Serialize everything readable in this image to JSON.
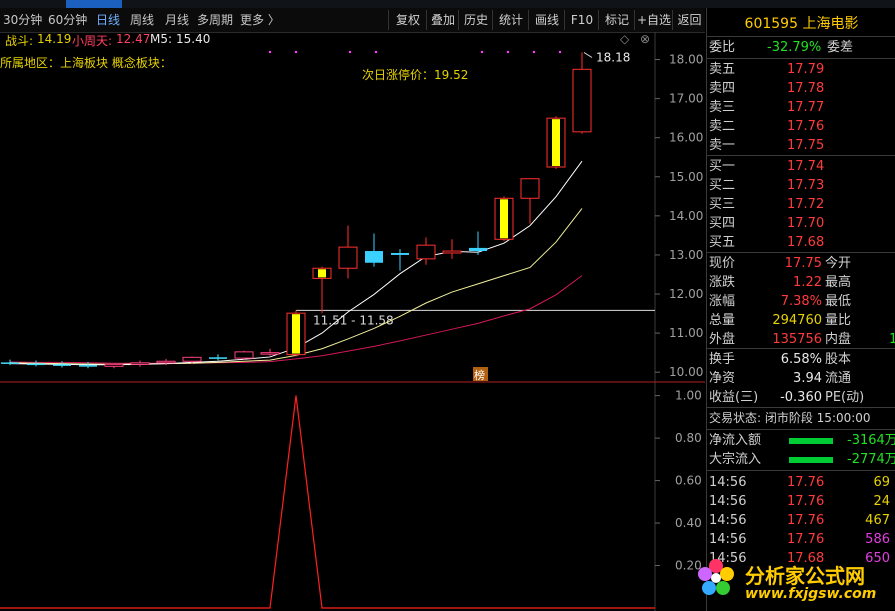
{
  "toolbar": {
    "periods": [
      "30分钟",
      "60分钟",
      "日线",
      "周线",
      "月线",
      "多周期",
      "更多 〉"
    ],
    "active_period": "日线",
    "right_buttons": [
      "复权",
      "叠加",
      "历史",
      "统计",
      "画线",
      "F10",
      "标记",
      "+自选",
      "返回"
    ]
  },
  "indicators": {
    "zhandou_label": "战斗:",
    "zhandou_value": "14.19",
    "xiaozhoutian_label": "小周天:",
    "xiaozhoutian_value": "12.47",
    "m5_label": "M5:",
    "m5_value": "15.40",
    "sector_line": "所属地区：上海板块   概念板块："
  },
  "annotations": {
    "limit_up_next_day": "次日涨停价：19.52",
    "high_price": "18.18",
    "range_label": "11.51 - 11.58",
    "bang_marker": "榜"
  },
  "chart_data": {
    "type": "candlestick",
    "price_axis": {
      "ticks": [
        "18.00",
        "17.00",
        "16.00",
        "15.00",
        "14.00",
        "13.00",
        "12.00",
        "11.00",
        "10.00"
      ],
      "ylim": [
        9.8,
        18.5
      ]
    },
    "indicator_axis": {
      "ticks": [
        "1.00",
        "0.80",
        "0.60",
        "0.40",
        "0.20"
      ],
      "ylim": [
        0,
        1.05
      ]
    },
    "candles": [
      {
        "o": 10.25,
        "h": 10.32,
        "l": 10.18,
        "c": 10.22
      },
      {
        "o": 10.22,
        "h": 10.3,
        "l": 10.15,
        "c": 10.2
      },
      {
        "o": 10.2,
        "h": 10.28,
        "l": 10.12,
        "c": 10.18
      },
      {
        "o": 10.18,
        "h": 10.26,
        "l": 10.1,
        "c": 10.15
      },
      {
        "o": 10.15,
        "h": 10.22,
        "l": 10.1,
        "c": 10.2
      },
      {
        "o": 10.2,
        "h": 10.3,
        "l": 10.14,
        "c": 10.24
      },
      {
        "o": 10.24,
        "h": 10.34,
        "l": 10.18,
        "c": 10.28
      },
      {
        "o": 10.28,
        "h": 10.4,
        "l": 10.22,
        "c": 10.38
      },
      {
        "o": 10.38,
        "h": 10.46,
        "l": 10.3,
        "c": 10.36
      },
      {
        "o": 10.36,
        "h": 10.55,
        "l": 10.32,
        "c": 10.52
      },
      {
        "o": 10.48,
        "h": 10.6,
        "l": 10.42,
        "c": 10.5
      },
      {
        "o": 10.45,
        "h": 11.58,
        "l": 10.4,
        "c": 11.51
      },
      {
        "o": 12.4,
        "h": 12.7,
        "l": 11.51,
        "c": 12.66
      },
      {
        "o": 12.66,
        "h": 13.75,
        "l": 12.4,
        "c": 13.2
      },
      {
        "o": 13.1,
        "h": 13.55,
        "l": 12.7,
        "c": 12.8
      },
      {
        "o": 13.05,
        "h": 13.15,
        "l": 12.6,
        "c": 13.0
      },
      {
        "o": 12.9,
        "h": 13.45,
        "l": 12.75,
        "c": 13.25
      },
      {
        "o": 13.05,
        "h": 13.4,
        "l": 12.9,
        "c": 13.1
      },
      {
        "o": 13.18,
        "h": 13.6,
        "l": 13.0,
        "c": 13.1
      },
      {
        "o": 13.4,
        "h": 14.5,
        "l": 13.35,
        "c": 14.45
      },
      {
        "o": 14.45,
        "h": 14.95,
        "l": 13.8,
        "c": 14.95
      },
      {
        "o": 15.25,
        "h": 16.55,
        "l": 15.2,
        "c": 16.5
      },
      {
        "o": 16.15,
        "h": 18.18,
        "l": 16.1,
        "c": 17.75
      }
    ],
    "ma_white": [
      10.22,
      10.21,
      10.2,
      10.19,
      10.19,
      10.2,
      10.22,
      10.25,
      10.28,
      10.33,
      10.39,
      10.62,
      11.0,
      11.54,
      11.99,
      12.52,
      12.96,
      13.09,
      13.07,
      13.3,
      13.75,
      14.49,
      15.4
    ],
    "ma_yellow": [
      10.24,
      10.23,
      10.22,
      10.21,
      10.2,
      10.21,
      10.22,
      10.23,
      10.25,
      10.28,
      10.31,
      10.43,
      10.6,
      10.85,
      11.12,
      11.43,
      11.77,
      12.05,
      12.26,
      12.47,
      12.68,
      13.33,
      14.19
    ],
    "ma_red": [
      10.26,
      10.25,
      10.25,
      10.24,
      10.23,
      10.23,
      10.23,
      10.23,
      10.24,
      10.25,
      10.27,
      10.34,
      10.42,
      10.54,
      10.66,
      10.8,
      10.95,
      11.1,
      11.25,
      11.44,
      11.62,
      11.98,
      12.47
    ],
    "indicator_values": [
      0,
      0,
      0,
      0,
      0,
      0,
      0,
      0,
      0,
      0,
      0,
      1.0,
      0,
      0,
      0,
      0,
      0,
      0,
      0,
      0,
      0,
      0,
      0
    ]
  },
  "quote": {
    "code_name": "601595 上海电影",
    "weibi_label": "委比",
    "weibi_value": "-32.79%",
    "weicha_label": "委差",
    "asks": [
      {
        "label": "卖五",
        "price": "17.79"
      },
      {
        "label": "卖四",
        "price": "17.78"
      },
      {
        "label": "卖三",
        "price": "17.77"
      },
      {
        "label": "卖二",
        "price": "17.76"
      },
      {
        "label": "卖一",
        "price": "17.75"
      }
    ],
    "bids": [
      {
        "label": "买一",
        "price": "17.74"
      },
      {
        "label": "买二",
        "price": "17.73"
      },
      {
        "label": "买三",
        "price": "17.72"
      },
      {
        "label": "买四",
        "price": "17.70"
      },
      {
        "label": "买五",
        "price": "17.68"
      }
    ],
    "stats": [
      {
        "l1": "现价",
        "v1": "17.75",
        "l2": "今开",
        "c": "red"
      },
      {
        "l1": "涨跌",
        "v1": "1.22",
        "l2": "最高",
        "c": "red"
      },
      {
        "l1": "涨幅",
        "v1": "7.38%",
        "l2": "最低",
        "c": "red"
      },
      {
        "l1": "总量",
        "v1": "294760",
        "l2": "量比",
        "c": "yellow"
      },
      {
        "l1": "外盘",
        "v1": "135756",
        "l2": "内盘",
        "c": "red",
        "v2": "1"
      }
    ],
    "stats2": [
      {
        "l1": "换手",
        "v1": "6.58%",
        "l2": "股本"
      },
      {
        "l1": "净资",
        "v1": "3.94",
        "l2": "流通"
      },
      {
        "l1": "收益(三)",
        "v1": "-0.360",
        "l2": "PE(动)"
      }
    ],
    "trade_status": "交易状态: 闭市阶段 15:00:00",
    "flows": [
      {
        "label": "净流入额",
        "value": "-3164万"
      },
      {
        "label": "大宗流入",
        "value": "-2774万"
      }
    ],
    "ticks": [
      {
        "time": "14:56",
        "price": "17.76",
        "vol": "69",
        "vc": "yellow"
      },
      {
        "time": "14:56",
        "price": "17.76",
        "vol": "24",
        "vc": "yellow"
      },
      {
        "time": "14:56",
        "price": "17.76",
        "vol": "467",
        "vc": "yellow"
      },
      {
        "time": "14:56",
        "price": "17.76",
        "vol": "586",
        "vc": "mag"
      },
      {
        "time": "14:56",
        "price": "17.68",
        "vol": "650",
        "vc": "mag"
      }
    ]
  },
  "watermark": {
    "text": "分析家公式网",
    "url": "www.fxjgsw.com"
  }
}
